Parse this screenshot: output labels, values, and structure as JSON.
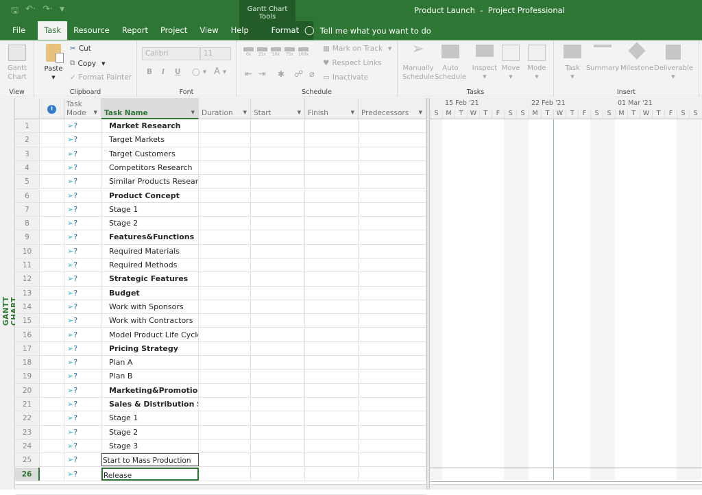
{
  "titlebar": {
    "document_title": "Product Launch  -  Project Professional",
    "contextual_group": "Gantt Chart Tools",
    "qat": [
      "save-icon",
      "undo-icon",
      "redo-icon",
      "customize-icon"
    ]
  },
  "tabs": [
    "File",
    "Task",
    "Resource",
    "Report",
    "Project",
    "View",
    "Help"
  ],
  "active_tab": "Task",
  "contextual_tab": "Format",
  "tell_me": "Tell me what you want to do",
  "ribbon": {
    "view": {
      "label": "View",
      "gantt_chart": "Gantt\nChart"
    },
    "clipboard": {
      "label": "Clipboard",
      "paste": "Paste",
      "cut": "Cut",
      "copy": "Copy",
      "format_painter": "Format Painter"
    },
    "font": {
      "label": "Font",
      "font_name": "Calibri",
      "font_size": "11",
      "bold": "B",
      "italic": "I",
      "underline": "U",
      "font_color": "A"
    },
    "schedule": {
      "label": "Schedule",
      "pct": [
        "0x",
        "25x",
        "50x",
        "75x",
        "100x"
      ],
      "mark_on_track": "Mark on Track",
      "respect_links": "Respect Links",
      "inactivate": "Inactivate"
    },
    "tasks": {
      "label": "Tasks",
      "manually": "Manually\nSchedule",
      "auto": "Auto\nSchedule",
      "inspect": "Inspect",
      "move": "Move",
      "mode": "Mode"
    },
    "insert": {
      "label": "Insert",
      "task": "Task",
      "summary": "Summary",
      "milestone": "Milestone",
      "deliverable": "Deliverable"
    }
  },
  "side_label": "GANTT CHART",
  "columns": {
    "task_mode": "Task\nMode",
    "task_name": "Task Name",
    "duration": "Duration",
    "start": "Start",
    "finish": "Finish",
    "predecessors": "Predecessors"
  },
  "tasks": [
    {
      "id": "1",
      "name": "Market Research",
      "bold": true
    },
    {
      "id": "2",
      "name": "Target Markets",
      "bold": false
    },
    {
      "id": "3",
      "name": "Target Customers",
      "bold": false
    },
    {
      "id": "4",
      "name": "Competitors Research",
      "bold": false
    },
    {
      "id": "5",
      "name": "Similar Products Research",
      "bold": false
    },
    {
      "id": "6",
      "name": "Product Concept",
      "bold": true
    },
    {
      "id": "7",
      "name": "Stage 1",
      "bold": false
    },
    {
      "id": "8",
      "name": "Stage 2",
      "bold": false
    },
    {
      "id": "9",
      "name": "Features&Functions",
      "bold": true
    },
    {
      "id": "10",
      "name": "Required Materials",
      "bold": false
    },
    {
      "id": "11",
      "name": "Required Methods",
      "bold": false
    },
    {
      "id": "12",
      "name": "Strategic Features",
      "bold": true
    },
    {
      "id": "13",
      "name": "Budget",
      "bold": true
    },
    {
      "id": "14",
      "name": "Work with Sponsors",
      "bold": false
    },
    {
      "id": "15",
      "name": "Work with Contractors",
      "bold": false
    },
    {
      "id": "16",
      "name": "Model Product Life Cycle",
      "bold": false
    },
    {
      "id": "17",
      "name": "Pricing Strategy",
      "bold": true
    },
    {
      "id": "18",
      "name": "Plan A",
      "bold": false
    },
    {
      "id": "19",
      "name": "Plan B",
      "bold": false
    },
    {
      "id": "20",
      "name": "Marketing&Promotion",
      "bold": true
    },
    {
      "id": "21",
      "name": "Sales & Distribution Strategy",
      "bold": true
    },
    {
      "id": "22",
      "name": "Stage 1",
      "bold": false
    },
    {
      "id": "23",
      "name": "Stage 2",
      "bold": false
    },
    {
      "id": "24",
      "name": "Stage 3",
      "bold": false
    },
    {
      "id": "25",
      "name": "Start to Mass Production",
      "bold": false,
      "editing": true
    },
    {
      "id": "26",
      "name": "Release",
      "bold": false,
      "selected": true
    }
  ],
  "timescale": {
    "weeks": [
      "15 Feb '21",
      "22 Feb '21",
      "01 Mar '21"
    ],
    "days": [
      "S",
      "M",
      "T",
      "W",
      "T",
      "F",
      "S",
      "S",
      "M",
      "T",
      "W",
      "T",
      "F",
      "S",
      "S",
      "M",
      "T",
      "W",
      "T",
      "F",
      "S",
      "S"
    ]
  },
  "colors": {
    "brand": "#2e7634",
    "context": "#235c28",
    "mode_icon": "#3ab3c8"
  }
}
